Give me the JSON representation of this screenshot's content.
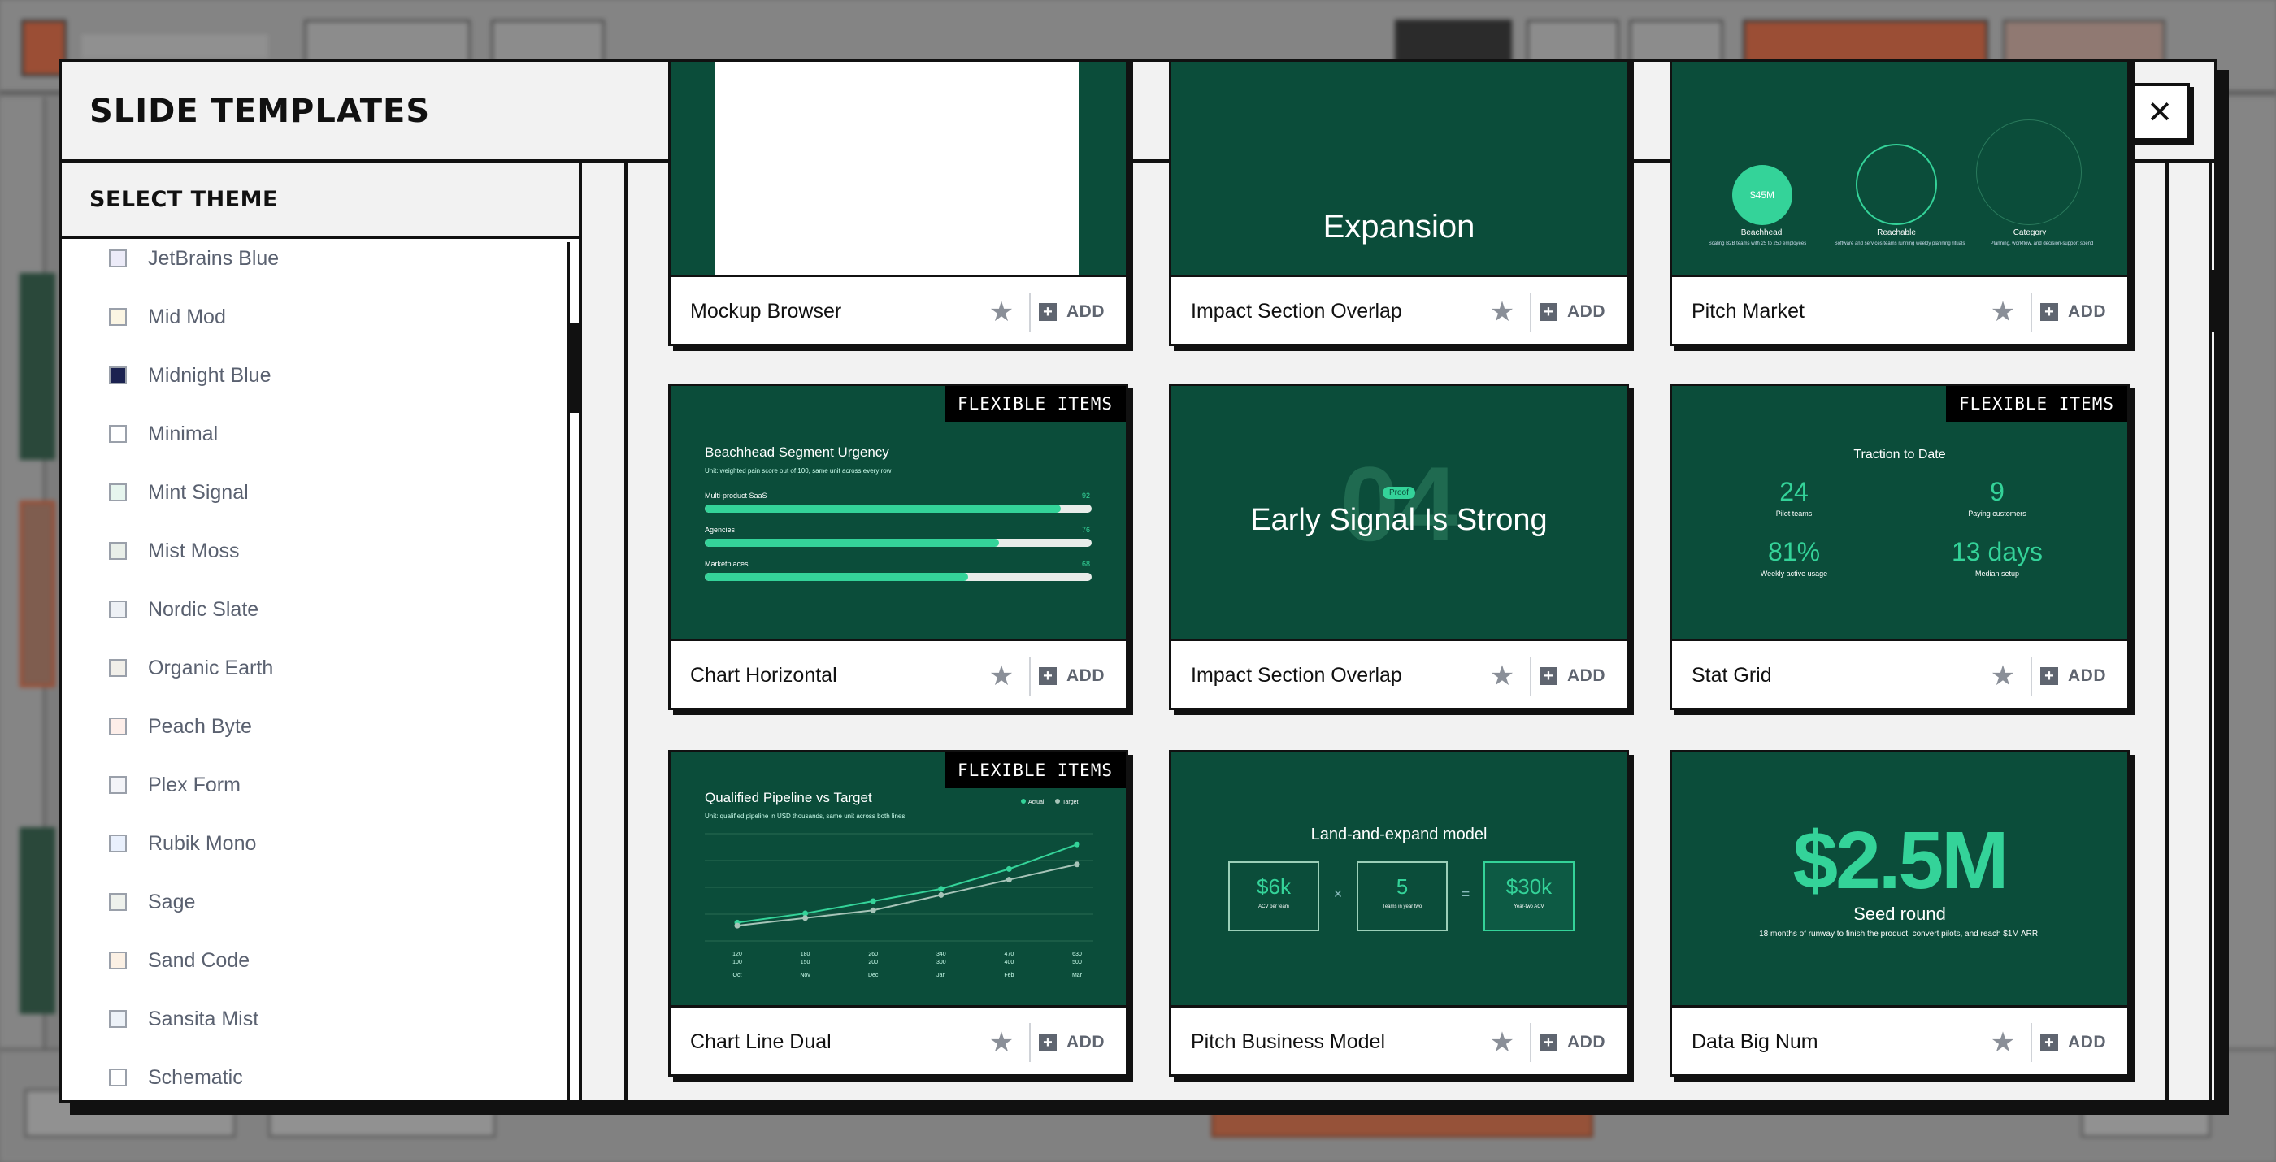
{
  "background_app": {},
  "modal": {
    "title": "SLIDE TEMPLATES",
    "close_glyph": "✕"
  },
  "sidebar": {
    "header": "SELECT THEME",
    "themes": [
      {
        "label": "JetBrains Blue",
        "swatch": "#ecebf8"
      },
      {
        "label": "Mid Mod",
        "swatch": "#fbf5e3"
      },
      {
        "label": "Midnight Blue",
        "swatch": "#1b2250"
      },
      {
        "label": "Minimal",
        "swatch": "#ffffff"
      },
      {
        "label": "Mint Signal",
        "swatch": "#e6f5ee"
      },
      {
        "label": "Mist Moss",
        "swatch": "#e9efe9"
      },
      {
        "label": "Nordic Slate",
        "swatch": "#eef1f5"
      },
      {
        "label": "Organic Earth",
        "swatch": "#f1efe9"
      },
      {
        "label": "Peach Byte",
        "swatch": "#fdeee9"
      },
      {
        "label": "Plex Form",
        "swatch": "#f3f4f8"
      },
      {
        "label": "Rubik Mono",
        "swatch": "#e9f0fc"
      },
      {
        "label": "Sage",
        "swatch": "#eef1ec"
      },
      {
        "label": "Sand Code",
        "swatch": "#fbf0e4"
      },
      {
        "label": "Sansita Mist",
        "swatch": "#edf2f8"
      },
      {
        "label": "Schematic",
        "swatch": "#ffffff"
      }
    ]
  },
  "common": {
    "add_label": "ADD",
    "badge_label": "FLEXIBLE ITEMS",
    "star_glyph": "★",
    "plus_glyph": "+"
  },
  "cards": {
    "mockup_browser": {
      "name": "Mockup Browser"
    },
    "impact_overlap_1": {
      "name": "Impact Section Overlap",
      "heading": "Expansion"
    },
    "pitch_market": {
      "name": "Pitch Market",
      "circles": [
        {
          "value": "$45M",
          "label": "Beachhead",
          "sub": "Scaling B2B teams with 25 to 250 employees"
        },
        {
          "value": "",
          "label": "Reachable",
          "sub": "Software and services teams running weekly planning rituals"
        },
        {
          "value": "",
          "label": "Category",
          "sub": "Planning, workflow, and decision-support spend"
        }
      ]
    },
    "chart_horizontal": {
      "name": "Chart Horizontal",
      "title": "Beachhead Segment Urgency",
      "subtitle": "Unit: weighted pain score out of 100, same unit across every row",
      "rows": [
        {
          "label": "Multi-product SaaS",
          "value": 92
        },
        {
          "label": "Agencies",
          "value": 76
        },
        {
          "label": "Marketplaces",
          "value": 68
        }
      ]
    },
    "impact_overlap_2": {
      "name": "Impact Section Overlap",
      "big_number": "04",
      "pill": "Proof",
      "heading": "Early Signal Is Strong"
    },
    "stat_grid": {
      "name": "Stat Grid",
      "title": "Traction to Date",
      "stats": [
        {
          "value": "24",
          "label": "Pilot teams"
        },
        {
          "value": "9",
          "label": "Paying customers"
        },
        {
          "value": "81%",
          "label": "Weekly active usage"
        },
        {
          "value": "13 days",
          "label": "Median setup"
        }
      ]
    },
    "chart_line_dual": {
      "name": "Chart Line Dual"
    },
    "pitch_business_model": {
      "name": "Pitch Business Model",
      "title": "Land-and-expand model",
      "boxes": [
        {
          "value": "$6k",
          "label": "ACV per team"
        },
        {
          "value": "5",
          "label": "Teams in year two"
        },
        {
          "value": "$30k",
          "label": "Year-two ACV"
        }
      ],
      "times": "×",
      "equals": "="
    },
    "data_big_num": {
      "name": "Data Big Num",
      "value": "$2.5M",
      "label": "Seed round",
      "description": "18 months of runway to finish the product, convert pilots, and reach $1M ARR."
    }
  },
  "chart_data": {
    "type": "line",
    "title": "Qualified Pipeline vs Target",
    "subtitle": "Unit: qualified pipeline in USD thousands, same unit across both lines",
    "categories": [
      "Oct",
      "Nov",
      "Dec",
      "Jan",
      "Feb",
      "Mar"
    ],
    "series": [
      {
        "name": "Actual",
        "values": [
          120,
          180,
          260,
          340,
          470,
          630
        ]
      },
      {
        "name": "Target",
        "values": [
          100,
          150,
          200,
          300,
          400,
          500
        ]
      }
    ],
    "ylim": [
      0,
      700
    ],
    "legend": "top-right",
    "grid": true,
    "colors": {
      "Actual": "#34d399",
      "Target": "#a7c4b8"
    }
  }
}
